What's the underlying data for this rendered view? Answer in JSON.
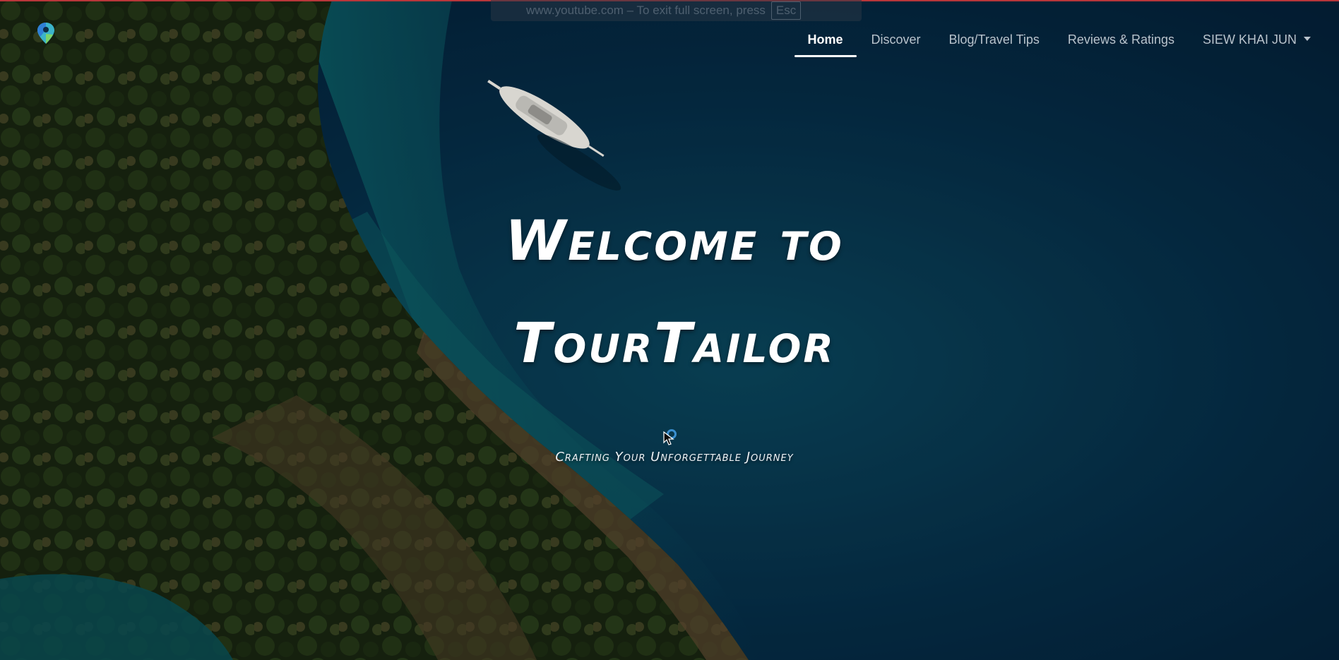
{
  "fullscreen_notice": {
    "text": "www.youtube.com – To exit full screen, press",
    "key": "Esc"
  },
  "brand": {
    "icon": "map-pin-logo-icon"
  },
  "nav": {
    "items": [
      {
        "label": "Home",
        "active": true
      },
      {
        "label": "Discover",
        "active": false
      },
      {
        "label": "Blog/Travel Tips",
        "active": false
      },
      {
        "label": "Reviews & Ratings",
        "active": false
      }
    ],
    "user_menu_label": "SIEW KHAI JUN"
  },
  "hero": {
    "title_line1": "Welcome to",
    "title_line2": "TourTailor",
    "subtitle": "Crafting Your Unforgettable Journey"
  },
  "colors": {
    "sea_deep": "#04223a",
    "sea_teal": "#0b5a6a",
    "land_green": "#2c3f1c",
    "nav_text": "#b9c3cc",
    "nav_active": "#ffffff",
    "loading_ring": "#3a8fd0"
  }
}
